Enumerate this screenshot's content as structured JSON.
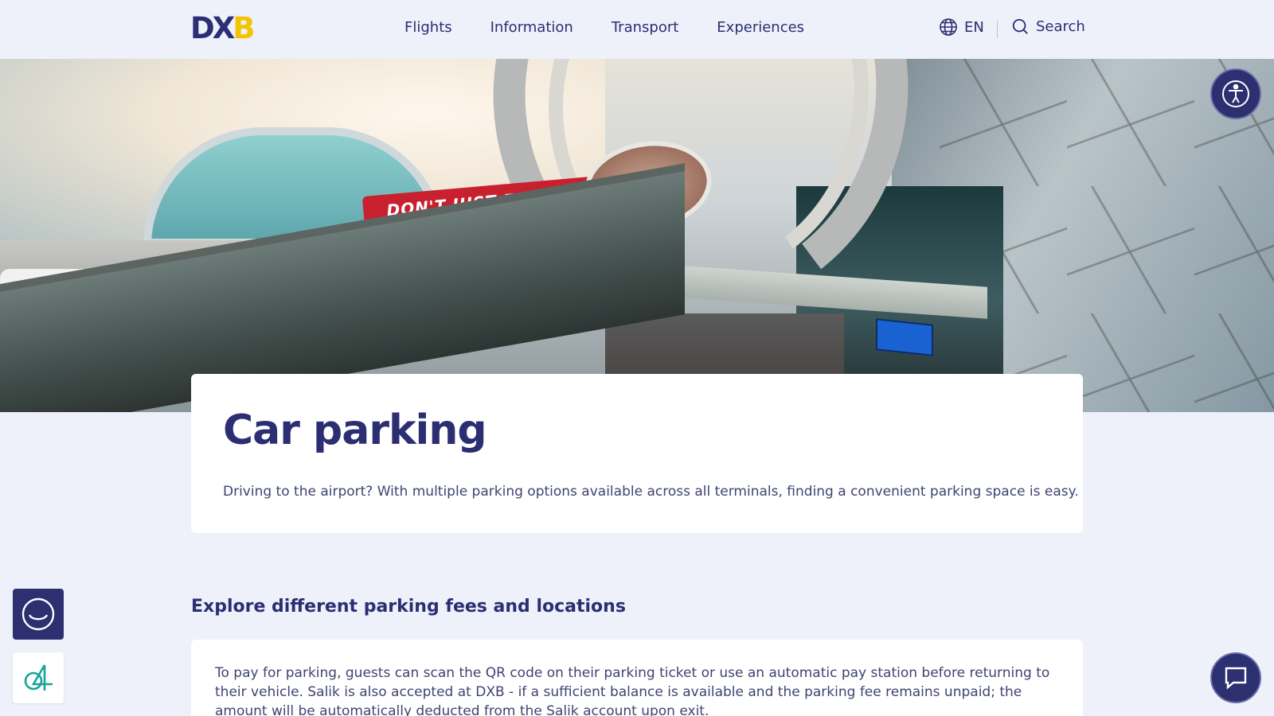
{
  "brand": {
    "logo_part1": "DX",
    "logo_part2": "B",
    "accent_color": "#f5c400",
    "primary_color": "#2b2e72"
  },
  "nav": {
    "items": [
      {
        "label": "Flights"
      },
      {
        "label": "Information"
      },
      {
        "label": "Transport"
      },
      {
        "label": "Experiences"
      }
    ]
  },
  "header": {
    "language": "EN",
    "search_label": "Search"
  },
  "hero": {
    "banner_text": "DON'T JUST FLY, FLY BETTER"
  },
  "page": {
    "title": "Car parking",
    "intro": "Driving to the airport? With multiple parking options available across all terminals, finding a convenient parking space is easy."
  },
  "section": {
    "title": "Explore different parking fees and locations",
    "body": "To pay for parking, guests can scan the QR code on their parking ticket or use an automatic pay station before returning to their vehicle. Salik is also accepted at DXB - if a sufficient balance is available and the parking fee remains unpaid; the amount will be automatically deducted from the Salik account upon exit."
  },
  "icons": {
    "language": "globe-icon",
    "search": "search-icon",
    "accessibility": "accessibility-icon",
    "feedback": "smile-icon",
    "app": "app-logo-icon",
    "chat": "chat-bubble-icon"
  }
}
